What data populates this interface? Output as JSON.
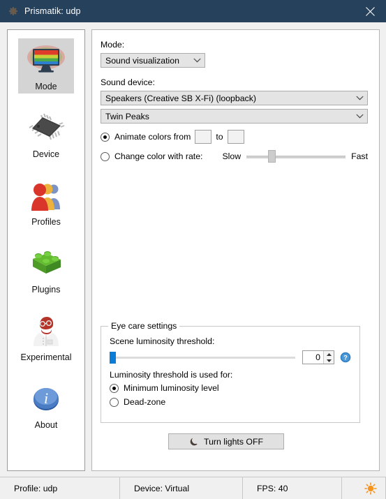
{
  "window": {
    "title": "Prismatik: udp",
    "gear_icon": "gear-icon",
    "close_icon": "close-icon",
    "titlebar_color": "#26415c"
  },
  "sidebar": {
    "items": [
      {
        "label": "Mode",
        "icon": "monitor-rainbow-icon",
        "selected": true
      },
      {
        "label": "Device",
        "icon": "microchip-icon",
        "selected": false
      },
      {
        "label": "Profiles",
        "icon": "people-pawns-icon",
        "selected": false
      },
      {
        "label": "Plugins",
        "icon": "lego-brick-icon",
        "selected": false
      },
      {
        "label": "Experimental",
        "icon": "scientist-icon",
        "selected": false
      },
      {
        "label": "About",
        "icon": "info-circle-icon",
        "selected": false
      }
    ]
  },
  "main": {
    "mode_label": "Mode:",
    "mode_value": "Sound visualization",
    "sound_device_label": "Sound device:",
    "sound_device_value": "Speakers (Creative SB X-Fi) (loopback)",
    "visualization_value": "Twin Peaks",
    "animate_colors": {
      "label": "Animate colors from",
      "selected": true,
      "to_label": "to",
      "color_from": "#0000cc",
      "color_to": "#fe0000"
    },
    "change_rate": {
      "label": "Change color with rate:",
      "selected": false,
      "slow_label": "Slow",
      "fast_label": "Fast",
      "value_percent": 25
    },
    "eye_care": {
      "legend": "Eye care settings",
      "threshold_label": "Scene luminosity threshold:",
      "threshold_value": "0",
      "threshold_percent": 0,
      "help_icon": "help-circle-icon",
      "used_for_label": "Luminosity threshold is used for:",
      "options": [
        {
          "label": "Minimum luminosity level",
          "selected": true
        },
        {
          "label": "Dead-zone",
          "selected": false
        }
      ]
    },
    "lights_button": {
      "label": "Turn lights OFF",
      "icon": "moon-icon"
    }
  },
  "statusbar": {
    "profile": "Profile: udp",
    "device": "Device: Virtual",
    "fps": "FPS: 40",
    "sun_icon": "sun-icon",
    "sun_color": "#f7941e"
  }
}
